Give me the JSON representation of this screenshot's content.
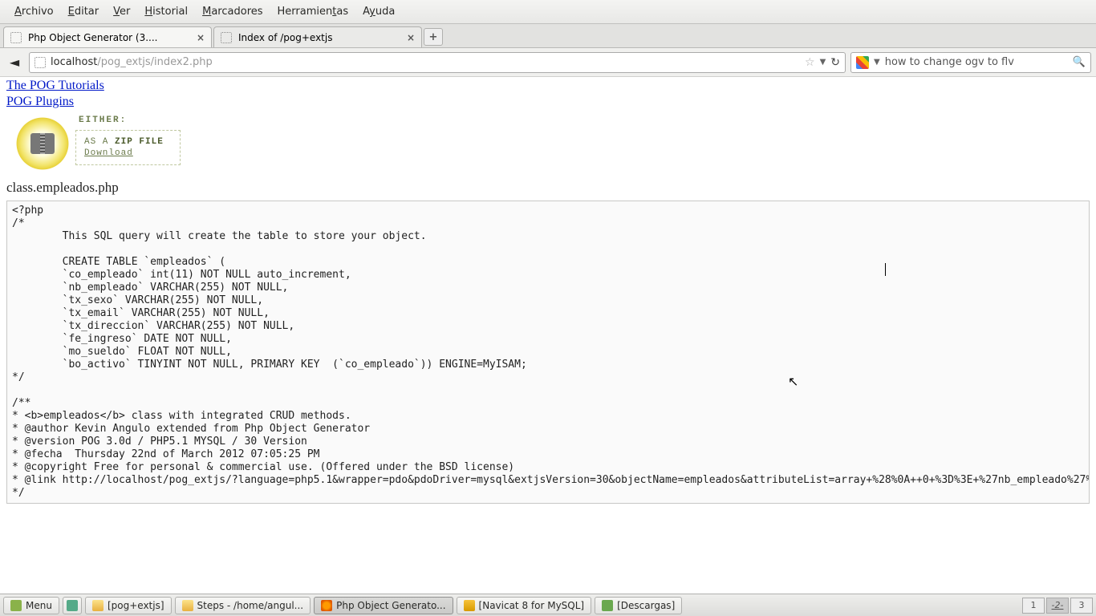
{
  "menubar": [
    "Archivo",
    "Editar",
    "Ver",
    "Historial",
    "Marcadores",
    "Herramientas",
    "Ayuda"
  ],
  "menubar_accel": [
    0,
    0,
    0,
    0,
    0,
    9,
    1
  ],
  "tabs": [
    {
      "title": "Php Object Generator (3....",
      "active": true
    },
    {
      "title": "Index of /pog+extjs",
      "active": false
    }
  ],
  "url": {
    "host": "localhost",
    "path": "/pog_extjs/index2.php"
  },
  "search": {
    "query": "how to change ogv to flv"
  },
  "page": {
    "links": [
      "The POG Tutorials",
      "POG Plugins"
    ],
    "either_label": "EITHER:",
    "zip_prefix": "AS A ",
    "zip_bold": "ZIP FILE",
    "download": "Download",
    "filename": "class.empleados.php",
    "code": "<?php\n/*\n        This SQL query will create the table to store your object.\n\n        CREATE TABLE `empleados` (\n        `co_empleado` int(11) NOT NULL auto_increment,\n        `nb_empleado` VARCHAR(255) NOT NULL,\n        `tx_sexo` VARCHAR(255) NOT NULL,\n        `tx_email` VARCHAR(255) NOT NULL,\n        `tx_direccion` VARCHAR(255) NOT NULL,\n        `fe_ingreso` DATE NOT NULL,\n        `mo_sueldo` FLOAT NOT NULL,\n        `bo_activo` TINYINT NOT NULL, PRIMARY KEY  (`co_empleado`)) ENGINE=MyISAM;\n*/\n\n/**\n* <b>empleados</b> class with integrated CRUD methods.\n* @author Kevin Angulo extended from Php Object Generator\n* @version POG 3.0d / PHP5.1 MYSQL / 30 Version\n* @fecha  Thursday 22nd of March 2012 07:05:25 PM\n* @copyright Free for personal & commercial use. (Offered under the BSD license)\n* @link http://localhost/pog_extjs/?language=php5.1&wrapper=pdo&pdoDriver=mysql&extjsVersion=30&objectName=empleados&attributeList=array+%28%0A++0+%3D%3E+%27nb_empleado%27%2C%0A++1+%3D%3E+%27tx_sexo%27%2C%0A++2+%3D%3E+%27tx_email%27%2C%0A++3+%3D%3E+%27tx_direccion%27%2C%0A++4+%3D%3E+%27fe_ingreso%27%2C%0A++5+%3D%3E+%27mo_sueldo%27%2C%0A++6+%3D%3E+%27bo_activo%27%2C%0A%29&typeList=array+%28%0A++0+%3D%3E+%27VARCHAR%28255%29%27%2C%0A++1+%3D%3E+%27VARCHAR%28255%29%27%2C%0A++2+%3D%3E+%27VARCHAR%28255%29%27%2C%0A++3+%3D%3E+%27VARCHAR%28255%29%27%2C%0A++4+%3D%3E+%27DATE%27%2C%0A++5+%3D%3E+%27FLOAT%27%2C%0A++6+%3D%3E+%27TINYINT%27%2C%0A%29&renderList=array+%28%0A++0+%3D%3E+%27Ext.form.TextField%27%2C%0A++1+%3D%3E+%27Ext.form.ComboBox%27%2C%0A++2+%3D%3E+%27Ext.form.TextField%27%2C%0A++3+%3D%3E+%27Ext.form.TextArea%27%2C%0A++4+%3D%3E+%27Ext.form.DateField%27%2C%0A++5+%3D%3E+%27Ext.form.TextField%27%2C%0A++6+%3D%3E+%27Ext.form.Checkbox%27%2C%0A%29\n*/"
  },
  "taskbar": {
    "menu": "Menu",
    "items": [
      {
        "label": "[pog+extjs]",
        "icon": "ic-folder"
      },
      {
        "label": "Steps - /home/angul...",
        "icon": "ic-folder"
      },
      {
        "label": "Php Object Generato...",
        "icon": "ic-firefox",
        "active": true
      },
      {
        "label": "[Navicat 8 for MySQL]",
        "icon": "ic-navicat"
      },
      {
        "label": "[Descargas]",
        "icon": "ic-dl"
      }
    ],
    "workspaces": [
      "1",
      "2",
      "3"
    ],
    "ws_active": 1
  }
}
